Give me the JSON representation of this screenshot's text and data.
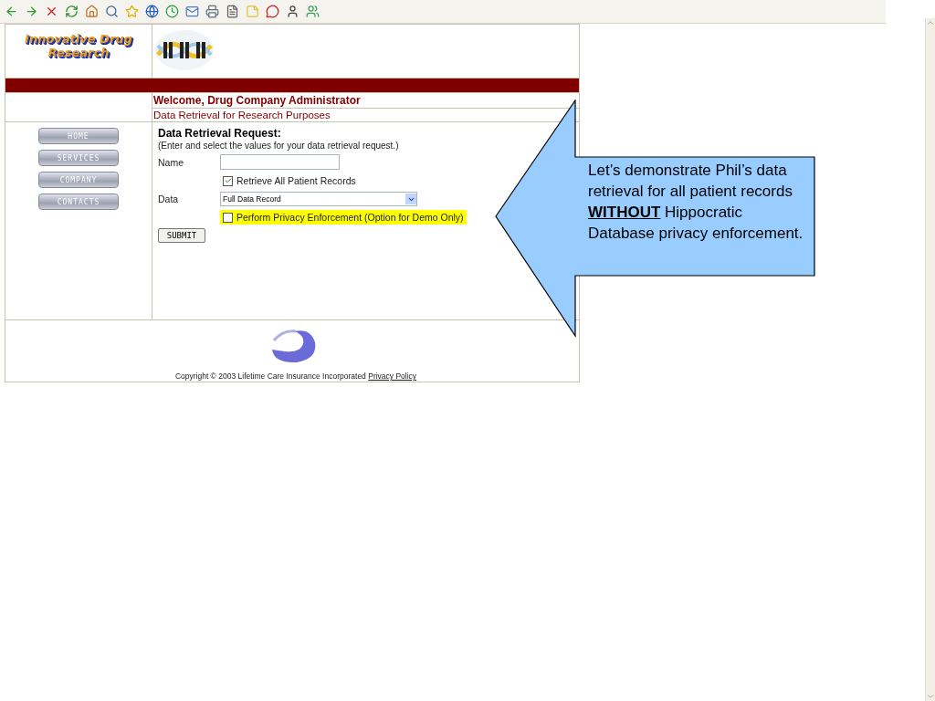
{
  "toolbar": {
    "icons": [
      {
        "kind": "back"
      },
      {
        "kind": "forward"
      },
      {
        "kind": "stop"
      },
      {
        "kind": "refresh"
      },
      {
        "kind": "home"
      },
      {
        "kind": "search"
      },
      {
        "kind": "favorites"
      },
      {
        "kind": "media"
      },
      {
        "kind": "history"
      },
      {
        "kind": "mail"
      },
      {
        "kind": "print"
      },
      {
        "kind": "edit"
      },
      {
        "kind": "notes"
      },
      {
        "kind": "messenger"
      },
      {
        "kind": "user"
      },
      {
        "kind": "contacts"
      }
    ]
  },
  "site": {
    "logo_text": "Innovative Drug Research",
    "welcome": "Welcome, Drug Company Administrator",
    "subtitle": "Data Retrieval for Research Purposes",
    "nav": [
      {
        "label": "HOME"
      },
      {
        "label": "SERVICES"
      },
      {
        "label": "COMPANY"
      },
      {
        "label": "CONTACTS"
      }
    ],
    "form": {
      "title": "Data Retrieval Request:",
      "hint": "(Enter and select the values for your data retrieval request.)",
      "name_label": "Name",
      "retrieve_all": {
        "label": "Retrieve All Patient Records",
        "checked": true
      },
      "data_label": "Data",
      "data_value": "Full Data Record",
      "privacy": {
        "label": "Perform Privacy Enforcement (Option for Demo Only)",
        "checked": false,
        "highlighted": true
      },
      "submit": "SUBMIT"
    },
    "footer": {
      "copyright": "Copyright © 2003 Lifetime Care Insurance Incorporated",
      "link": "Privacy Policy"
    }
  },
  "callout": {
    "text": "Let’s demonstrate Phil’s data retrieval for all patient records **WITHOUT** Hippocratic Database privacy enforcement."
  }
}
